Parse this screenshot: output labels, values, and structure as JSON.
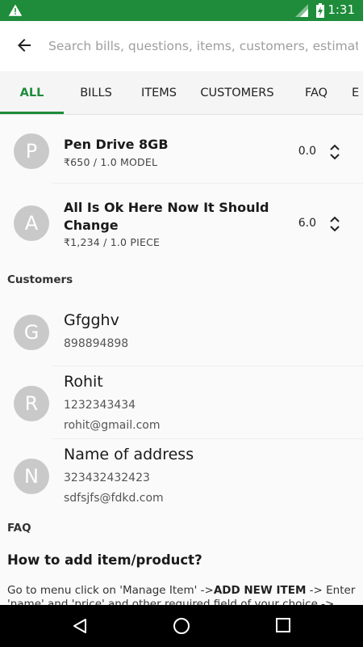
{
  "status_bar": {
    "time": "1:31",
    "warning_icon": "warning-icon",
    "signal_icon": "cell-signal-icon",
    "battery_icon": "battery-charging-icon"
  },
  "search": {
    "placeholder": "Search bills, questions, items, customers, estimates",
    "value": ""
  },
  "tabs": [
    {
      "label": "ALL",
      "active": true
    },
    {
      "label": "BILLS"
    },
    {
      "label": "ITEMS"
    },
    {
      "label": "CUSTOMERS"
    },
    {
      "label": "FAQ"
    },
    {
      "label": "E"
    }
  ],
  "items": [
    {
      "initial": "P",
      "name": "Pen Drive 8GB",
      "price": "₹650 / 1.0 MODEL",
      "qty": "0.0"
    },
    {
      "initial": "A",
      "name_line1": "All Is Ok Here Now It Should",
      "name_line2": "Change",
      "price": "₹1,234 / 1.0 PIECE",
      "qty": "6.0"
    }
  ],
  "customers_section": {
    "title": "Customers"
  },
  "customers": [
    {
      "initial": "G",
      "name": "Gfgghv",
      "phone": "898894898"
    },
    {
      "initial": "R",
      "name": "Rohit",
      "phone": "1232343434",
      "email": "rohit@gmail.com"
    },
    {
      "initial": "N",
      "name": "Name of address",
      "phone": "323432432423",
      "email": "sdfsjfs@fdkd.com"
    }
  ],
  "faq_section": {
    "title": "FAQ",
    "question": "How to add item/product?",
    "answer_part1": "Go to menu click on 'Manage Item' ->",
    "answer_bold": "ADD NEW ITEM",
    "answer_part2": " -> Enter 'name' and 'price' and other required field of your choice -> click"
  },
  "colors": {
    "brand": "#1e8c3a",
    "avatar": "#c9c9c9"
  }
}
